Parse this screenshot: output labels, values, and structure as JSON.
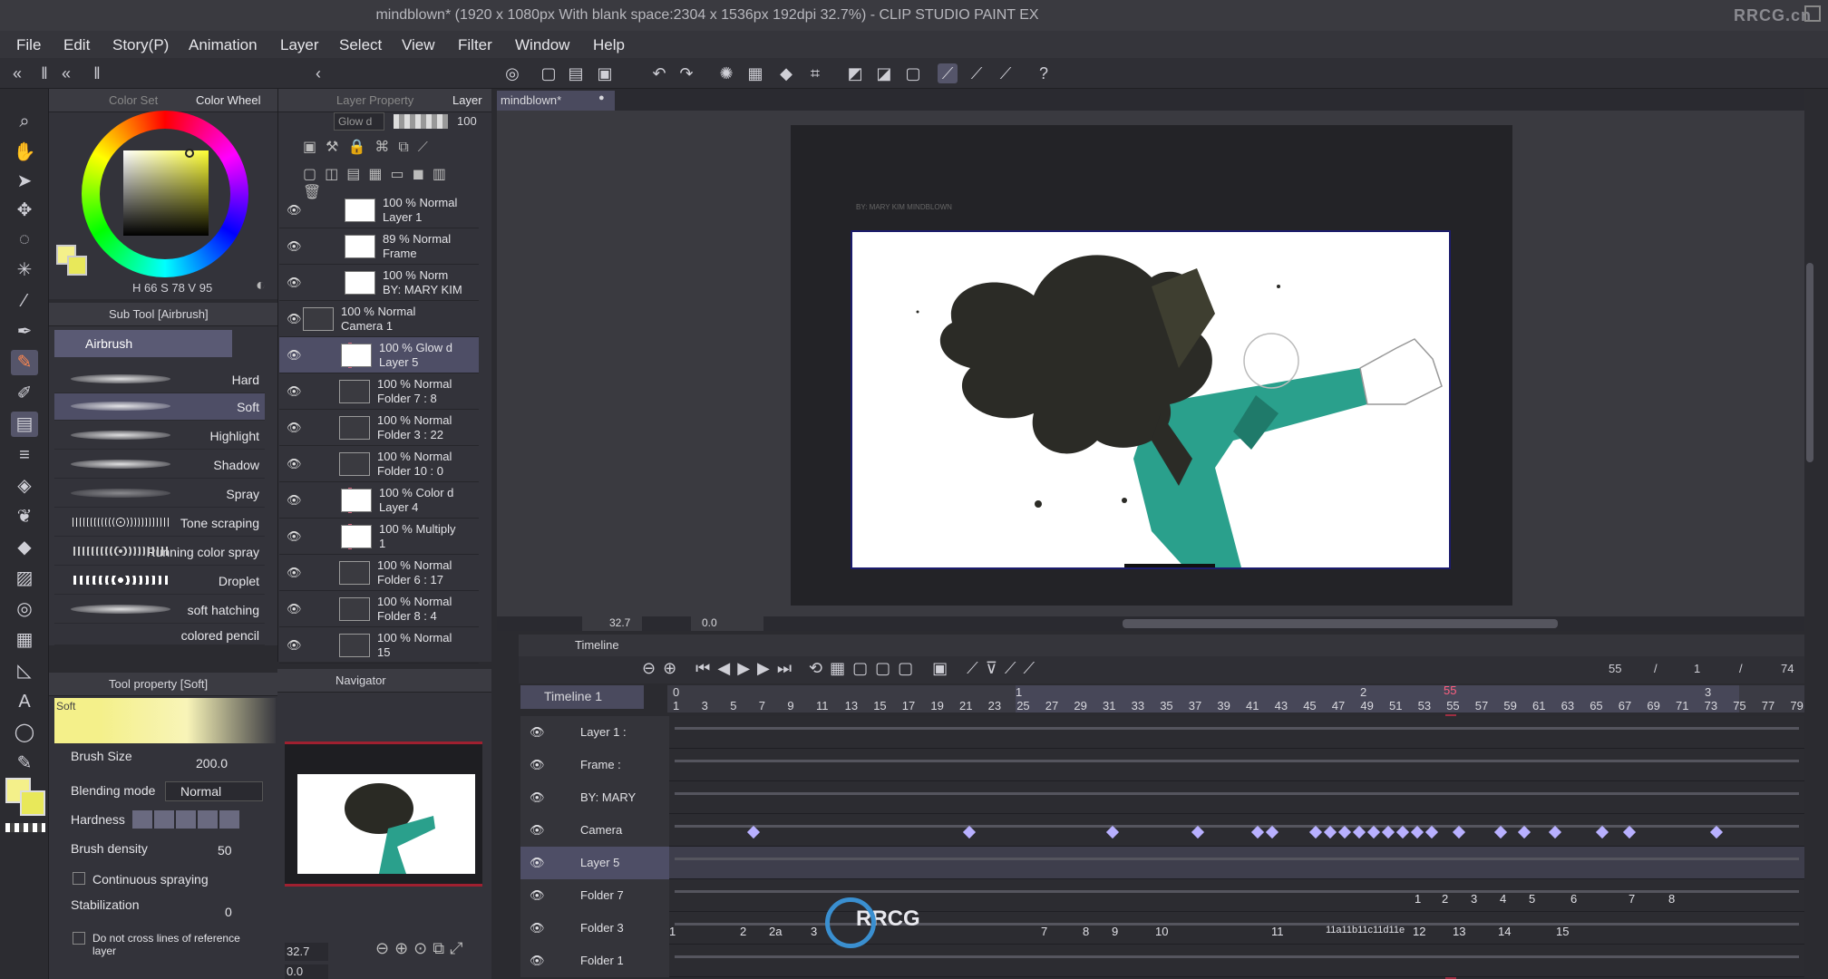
{
  "window": {
    "title": "mindblown* (1920 x 1080px With blank space:2304 x 1536px 192dpi 32.7%)  - CLIP STUDIO PAINT EX",
    "watermark": "RRCG.cn"
  },
  "menu": [
    "File",
    "Edit",
    "Story(P)",
    "Animation",
    "Layer",
    "Select",
    "View",
    "Filter",
    "Window",
    "Help"
  ],
  "color_panel": {
    "tabs": [
      "Color Set",
      "Color Wheel"
    ],
    "hsv_label": "H 66 S 78 V 95",
    "main_color": "#f4f08a",
    "sub_color": "#e8e85a"
  },
  "subtool_panel": {
    "title": "Sub Tool [Airbrush]",
    "group": "Airbrush",
    "brushes": [
      "Hard",
      "Soft",
      "Highlight",
      "Shadow",
      "Spray",
      "Tone scraping",
      "Running color spray",
      "Droplet",
      "soft hatching",
      "colored pencil"
    ],
    "selected": "Soft"
  },
  "tool_property": {
    "title": "Tool property [Soft]",
    "preview_label": "Soft",
    "brush_size_label": "Brush Size",
    "brush_size_value": "200.0",
    "blending_mode_label": "Blending mode",
    "blending_mode_value": "Normal",
    "hardness_label": "Hardness",
    "brush_density_label": "Brush density",
    "brush_density_value": "50",
    "continuous_label": "Continuous spraying",
    "stabilization_label": "Stabilization",
    "stabilization_value": "0",
    "no_cross_label": "Do not cross lines of reference layer"
  },
  "layer_panel": {
    "tabs": [
      "Layer Property",
      "Layer"
    ],
    "blend_select": "Glow d",
    "opacity": "100",
    "layers": [
      {
        "line1": "100 % Normal",
        "line2": "Layer 1"
      },
      {
        "line1": "89 % Normal",
        "line2": "Frame"
      },
      {
        "line1": "100 % Norm",
        "line2": "BY: MARY KIM"
      },
      {
        "line1": "100 % Normal",
        "line2": "Camera 1"
      },
      {
        "line1": "100 % Glow d",
        "line2": "Layer 5"
      },
      {
        "line1": "100 % Normal",
        "line2": "Folder 7 : 8"
      },
      {
        "line1": "100 % Normal",
        "line2": "Folder 3 : 22"
      },
      {
        "line1": "100 % Normal",
        "line2": "Folder 10 : 0"
      },
      {
        "line1": "100 % Color d",
        "line2": "Layer 4"
      },
      {
        "line1": "100 % Multiply",
        "line2": "1"
      },
      {
        "line1": "100 % Normal",
        "line2": "Folder 6 : 17"
      },
      {
        "line1": "100 % Normal",
        "line2": "Folder 8 : 4"
      },
      {
        "line1": "100 % Normal",
        "line2": "15"
      }
    ]
  },
  "navigator": {
    "title": "Navigator",
    "zoom": "32.7",
    "angle": "0.0"
  },
  "canvas": {
    "tab": "mindblown*",
    "credit": "BY: MARY KIM MINDBLOWN",
    "zoom": "32.7",
    "angle": "0.0"
  },
  "timeline": {
    "title": "Timeline",
    "name": "Timeline 1",
    "current_frame": "55",
    "readout_a": "55",
    "readout_b": "1",
    "readout_c": "74",
    "sep": "/",
    "section_marks": [
      "0",
      "1",
      "2",
      "3"
    ],
    "frame_numbers": [
      "1",
      "3",
      "5",
      "7",
      "9",
      "11",
      "13",
      "15",
      "17",
      "19",
      "21",
      "23",
      "25",
      "27",
      "29",
      "31",
      "33",
      "35",
      "37",
      "39",
      "41",
      "43",
      "45",
      "47",
      "49",
      "51",
      "53",
      "55",
      "57",
      "59",
      "61",
      "63",
      "65",
      "67",
      "69",
      "71",
      "73",
      "75",
      "77",
      "79"
    ],
    "tracks": [
      "Layer 1 :",
      "Frame :",
      "BY: MARY",
      "Camera",
      "Layer 5",
      "Folder 7",
      "Folder 3",
      "Folder 1"
    ],
    "folder7_cels": [
      "1",
      "2",
      "3",
      "4",
      "5",
      "6",
      "7",
      "8"
    ],
    "folder3_cels": [
      "1",
      "2",
      "2a",
      "3",
      "7",
      "8",
      "9",
      "10",
      "11",
      "11a11b11c11d11e",
      "12",
      "13",
      "14",
      "15"
    ]
  },
  "colors": {
    "accent_selection": "#4e4e66",
    "keyframe": "#b8b0ff",
    "playhead": "#d0304a",
    "jacket": "#2aa08c"
  }
}
